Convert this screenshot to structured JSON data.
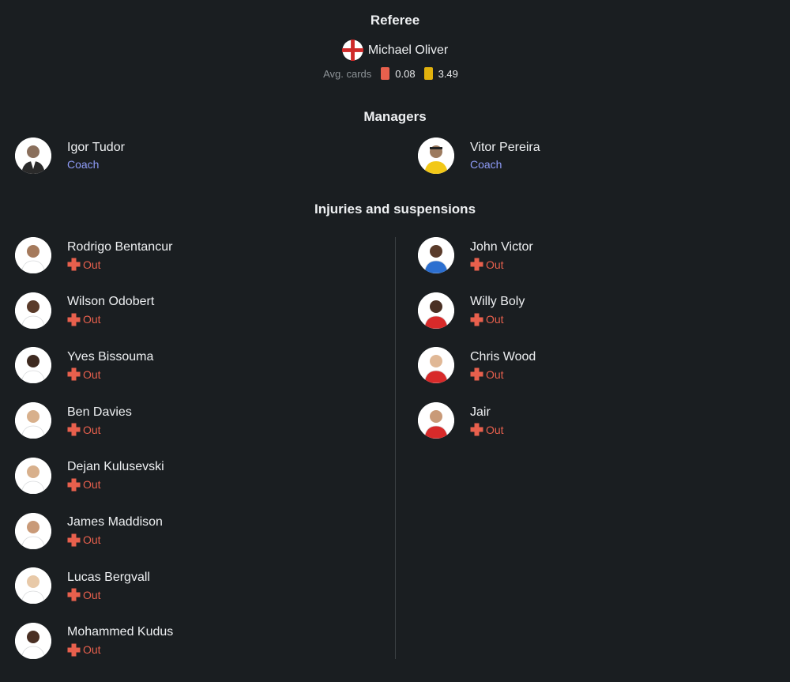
{
  "referee": {
    "title": "Referee",
    "name": "Michael Oliver",
    "flag_icon": "england-flag-icon",
    "avg_cards_label": "Avg. cards",
    "red_avg": "0.08",
    "yellow_avg": "3.49",
    "red_color": "#e8604d",
    "yellow_color": "#e0b10d"
  },
  "managers": {
    "title": "Managers",
    "home": {
      "name": "Igor Tudor",
      "role": "Coach"
    },
    "away": {
      "name": "Vitor Pereira",
      "role": "Coach"
    }
  },
  "injuries": {
    "title": "Injuries and suspensions",
    "home": [
      {
        "name": "Rodrigo Bentancur",
        "status": "Out"
      },
      {
        "name": "Wilson Odobert",
        "status": "Out"
      },
      {
        "name": "Yves Bissouma",
        "status": "Out"
      },
      {
        "name": "Ben Davies",
        "status": "Out"
      },
      {
        "name": "Dejan Kulusevski",
        "status": "Out"
      },
      {
        "name": "James Maddison",
        "status": "Out"
      },
      {
        "name": "Lucas Bergvall",
        "status": "Out"
      },
      {
        "name": "Mohammed Kudus",
        "status": "Out"
      }
    ],
    "away": [
      {
        "name": "John Victor",
        "status": "Out"
      },
      {
        "name": "Willy Boly",
        "status": "Out"
      },
      {
        "name": "Chris Wood",
        "status": "Out"
      },
      {
        "name": "Jair",
        "status": "Out"
      }
    ]
  },
  "colors": {
    "background": "#1a1e21",
    "accent_coach": "#8e9bf7",
    "status_out": "#e8604d"
  }
}
